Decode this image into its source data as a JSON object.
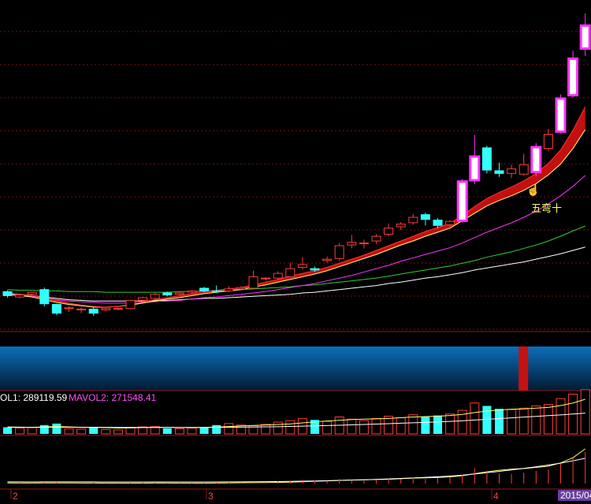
{
  "chart_data": {
    "type": "candlestick",
    "price_panel": {
      "candles": [
        {
          "o": 29.8,
          "h": 30.0,
          "l": 28.9,
          "c": 29.2,
          "up": false
        },
        {
          "o": 29.0,
          "h": 29.4,
          "l": 28.8,
          "c": 29.3,
          "up": true
        },
        {
          "o": 29.4,
          "h": 29.8,
          "l": 29.1,
          "c": 29.7,
          "up": true
        },
        {
          "o": 30.1,
          "h": 30.4,
          "l": 27.6,
          "c": 28.0,
          "up": false
        },
        {
          "o": 27.9,
          "h": 28.0,
          "l": 26.3,
          "c": 26.6,
          "up": false
        },
        {
          "o": 27.3,
          "h": 27.6,
          "l": 26.8,
          "c": 27.4,
          "up": true
        },
        {
          "o": 27.2,
          "h": 27.5,
          "l": 26.6,
          "c": 27.1,
          "up": true
        },
        {
          "o": 27.2,
          "h": 27.5,
          "l": 26.2,
          "c": 26.6,
          "up": false
        },
        {
          "o": 27.1,
          "h": 27.5,
          "l": 26.9,
          "c": 27.3,
          "up": true
        },
        {
          "o": 27.2,
          "h": 27.5,
          "l": 27.0,
          "c": 27.3,
          "up": true
        },
        {
          "o": 27.3,
          "h": 28.6,
          "l": 27.2,
          "c": 28.5,
          "up": true
        },
        {
          "o": 28.5,
          "h": 29.0,
          "l": 28.4,
          "c": 28.9,
          "up": true
        },
        {
          "o": 28.8,
          "h": 29.6,
          "l": 28.6,
          "c": 29.4,
          "up": true
        },
        {
          "o": 29.6,
          "h": 29.8,
          "l": 29.1,
          "c": 29.3,
          "up": false
        },
        {
          "o": 29.4,
          "h": 29.8,
          "l": 29.3,
          "c": 29.6,
          "up": true
        },
        {
          "o": 29.7,
          "h": 30.0,
          "l": 29.5,
          "c": 29.9,
          "up": true
        },
        {
          "o": 29.9,
          "h": 30.5,
          "l": 29.7,
          "c": 30.3,
          "up": false
        },
        {
          "o": 29.8,
          "h": 30.7,
          "l": 29.6,
          "c": 29.9,
          "up": false
        },
        {
          "o": 29.9,
          "h": 30.6,
          "l": 29.7,
          "c": 30.2,
          "up": true
        },
        {
          "o": 30.2,
          "h": 30.6,
          "l": 30.0,
          "c": 30.4,
          "up": true
        },
        {
          "o": 30.3,
          "h": 32.9,
          "l": 30.2,
          "c": 32.0,
          "up": true
        },
        {
          "o": 31.7,
          "h": 31.9,
          "l": 31.4,
          "c": 31.8,
          "up": true
        },
        {
          "o": 31.8,
          "h": 32.8,
          "l": 31.6,
          "c": 32.5,
          "up": true
        },
        {
          "o": 32.0,
          "h": 34.1,
          "l": 31.9,
          "c": 33.2,
          "up": true
        },
        {
          "o": 33.4,
          "h": 34.9,
          "l": 33.1,
          "c": 33.8,
          "up": true
        },
        {
          "o": 33.2,
          "h": 33.5,
          "l": 32.7,
          "c": 33.0,
          "up": false
        },
        {
          "o": 34.4,
          "h": 35.0,
          "l": 34.1,
          "c": 34.6,
          "up": true
        },
        {
          "o": 34.7,
          "h": 37.0,
          "l": 34.4,
          "c": 36.6,
          "up": true
        },
        {
          "o": 36.7,
          "h": 38.2,
          "l": 36.2,
          "c": 37.1,
          "up": true
        },
        {
          "o": 37.0,
          "h": 37.5,
          "l": 36.2,
          "c": 36.9,
          "up": true
        },
        {
          "o": 37.3,
          "h": 38.3,
          "l": 36.9,
          "c": 38.0,
          "up": true
        },
        {
          "o": 38.3,
          "h": 39.9,
          "l": 38.0,
          "c": 39.2,
          "up": true
        },
        {
          "o": 39.4,
          "h": 40.1,
          "l": 38.9,
          "c": 39.8,
          "up": true
        },
        {
          "o": 40.0,
          "h": 41.3,
          "l": 39.7,
          "c": 40.8,
          "up": true
        },
        {
          "o": 41.2,
          "h": 41.5,
          "l": 39.6,
          "c": 40.5,
          "up": false
        },
        {
          "o": 40.4,
          "h": 40.7,
          "l": 39.2,
          "c": 39.6,
          "up": false
        },
        {
          "o": 39.7,
          "h": 40.4,
          "l": 39.4,
          "c": 40.2,
          "up": true
        },
        {
          "o": 40.3,
          "h": 46.5,
          "l": 40.0,
          "c": 46.1,
          "up": true
        },
        {
          "o": 46.3,
          "h": 53.0,
          "l": 45.7,
          "c": 49.8,
          "up": true
        },
        {
          "o": 51.1,
          "h": 51.4,
          "l": 47.3,
          "c": 47.8,
          "up": false
        },
        {
          "o": 47.7,
          "h": 48.9,
          "l": 46.8,
          "c": 47.3,
          "up": false
        },
        {
          "o": 47.3,
          "h": 48.6,
          "l": 46.6,
          "c": 48.0,
          "up": true
        },
        {
          "o": 47.2,
          "h": 50.2,
          "l": 47.0,
          "c": 48.6,
          "up": true
        },
        {
          "o": 47.5,
          "h": 51.8,
          "l": 46.9,
          "c": 51.2,
          "up": true
        },
        {
          "o": 51.0,
          "h": 53.9,
          "l": 50.6,
          "c": 53.1,
          "up": true
        },
        {
          "o": 53.5,
          "h": 59.0,
          "l": 53.2,
          "c": 58.4,
          "up": true
        },
        {
          "o": 58.9,
          "h": 65.5,
          "l": 58.6,
          "c": 64.3,
          "up": true
        },
        {
          "o": 65.8,
          "h": 71.0,
          "l": 64.7,
          "c": 69.2,
          "up": true
        }
      ],
      "ma_lines": [
        {
          "color": "#ffffff",
          "values": [
            29.6,
            29.4,
            29.2,
            29.0,
            28.8,
            28.6,
            28.5,
            28.4,
            28.4,
            28.4,
            28.4,
            28.4,
            28.5,
            28.5,
            28.6,
            28.7,
            28.8,
            28.8,
            28.9,
            29.0,
            29.1,
            29.2,
            29.3,
            29.4,
            29.6,
            29.7,
            29.9,
            30.1,
            30.3,
            30.5,
            30.7,
            31.0,
            31.2,
            31.5,
            31.8,
            32.0,
            32.3,
            32.6,
            33.0,
            33.3,
            33.6,
            33.9,
            34.2,
            34.6,
            35.0,
            35.4,
            35.9,
            36.4
          ]
        },
        {
          "color": "#33cc33",
          "values": [
            30.1,
            30.0,
            30.0,
            29.9,
            29.9,
            29.8,
            29.8,
            29.8,
            29.7,
            29.7,
            29.7,
            29.7,
            29.7,
            29.7,
            29.8,
            29.8,
            29.9,
            29.9,
            30.0,
            30.1,
            30.2,
            30.3,
            30.4,
            30.5,
            30.7,
            30.8,
            31.0,
            31.2,
            31.4,
            31.6,
            31.8,
            32.1,
            32.4,
            32.7,
            33.0,
            33.3,
            33.6,
            34.0,
            34.4,
            34.9,
            35.3,
            35.7,
            36.2,
            36.7,
            37.3,
            38.0,
            38.8,
            39.5
          ]
        },
        {
          "color": "#ff33ff",
          "values": [
            29.5,
            29.3,
            29.1,
            28.9,
            28.6,
            28.4,
            28.3,
            28.2,
            28.1,
            28.1,
            28.1,
            28.2,
            28.3,
            28.4,
            28.5,
            28.7,
            28.9,
            29.0,
            29.2,
            29.4,
            29.6,
            29.8,
            30.1,
            30.4,
            30.7,
            31.0,
            31.4,
            31.8,
            32.2,
            32.7,
            33.2,
            33.7,
            34.3,
            34.8,
            35.3,
            35.8,
            36.3,
            37.0,
            37.8,
            38.6,
            39.3,
            40.0,
            40.8,
            41.7,
            42.8,
            44.0,
            45.4,
            47.0
          ]
        },
        {
          "color": "#ffff66",
          "values": [
            29.4,
            29.2,
            29.0,
            28.6,
            28.2,
            27.9,
            27.7,
            27.5,
            27.5,
            27.6,
            27.8,
            28.1,
            28.4,
            28.7,
            28.9,
            29.2,
            29.5,
            29.7,
            29.9,
            30.1,
            30.5,
            30.8,
            31.2,
            31.6,
            32.0,
            32.4,
            32.9,
            33.5,
            34.1,
            34.7,
            35.3,
            36.0,
            36.7,
            37.3,
            38.0,
            38.6,
            39.2,
            40.3,
            41.4,
            42.5,
            43.3,
            44.0,
            44.8,
            45.8,
            47.1,
            48.7,
            51.0,
            53.8
          ]
        },
        {
          "color": "#ff3333",
          "values": [
            29.6,
            29.4,
            29.2,
            28.9,
            28.5,
            28.1,
            27.8,
            27.6,
            27.5,
            27.6,
            27.9,
            28.3,
            28.6,
            28.9,
            29.2,
            29.5,
            29.8,
            30.0,
            30.2,
            30.4,
            30.8,
            31.2,
            31.6,
            32.1,
            32.5,
            32.9,
            33.4,
            34.0,
            34.6,
            35.2,
            35.9,
            36.6,
            37.3,
            38.0,
            38.7,
            39.3,
            39.9,
            41.1,
            42.4,
            43.6,
            44.5,
            45.3,
            46.2,
            47.3,
            48.8,
            50.8,
            53.7,
            57.2
          ]
        }
      ],
      "ribbon": {
        "upper_index": 4,
        "lower_index": 3,
        "color": "#cc1111"
      }
    },
    "annotation": {
      "text": "五弯十"
    },
    "indicators": {
      "vol_label": "OL1: 289119.59",
      "mavol2_label": "MAVOL2: 271548.41"
    },
    "volume": {
      "values": [
        90,
        80,
        85,
        120,
        140,
        70,
        65,
        95,
        60,
        55,
        90,
        95,
        100,
        75,
        70,
        80,
        85,
        120,
        140,
        120,
        110,
        130,
        160,
        180,
        210,
        190,
        170,
        230,
        200,
        180,
        210,
        240,
        220,
        260,
        230,
        250,
        270,
        320,
        420,
        380,
        340,
        330,
        350,
        380,
        400,
        480,
        540,
        600
      ],
      "mavol_yellow": [
        95,
        92,
        90,
        95,
        100,
        95,
        90,
        88,
        85,
        80,
        82,
        85,
        88,
        88,
        85,
        85,
        87,
        92,
        100,
        108,
        115,
        120,
        128,
        135,
        150,
        165,
        175,
        185,
        195,
        200,
        205,
        210,
        220,
        230,
        235,
        240,
        250,
        265,
        290,
        310,
        325,
        335,
        340,
        350,
        360,
        385,
        420,
        470
      ],
      "mavol_white": [
        90,
        90,
        89,
        90,
        91,
        91,
        90,
        90,
        89,
        88,
        88,
        88,
        88,
        88,
        88,
        88,
        88,
        89,
        90,
        92,
        94,
        96,
        98,
        101,
        105,
        109,
        113,
        118,
        123,
        128,
        133,
        139,
        145,
        151,
        157,
        163,
        170,
        178,
        188,
        198,
        208,
        218,
        228,
        238,
        248,
        258,
        270,
        282
      ]
    },
    "flow_bar": {
      "highlight_index": 42
    },
    "x_ticks": [
      "2",
      "3",
      "4"
    ],
    "cursor_date": "2015/04"
  }
}
